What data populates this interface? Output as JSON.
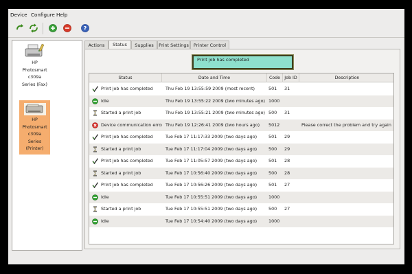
{
  "menubar": {
    "items": [
      "Device",
      "Configure",
      "Help"
    ]
  },
  "toolbar": {
    "buttons": [
      {
        "icon": "refresh-device-icon",
        "color": "#3a8a1c"
      },
      {
        "icon": "refresh-all-icon",
        "color": "#3a8a1c"
      },
      {
        "icon": "add-device-icon",
        "color": "#3aa23a"
      },
      {
        "icon": "remove-device-icon",
        "color": "#d83a2a"
      },
      {
        "icon": "help-icon",
        "color": "#3a62b8"
      }
    ]
  },
  "devices": [
    {
      "label_lines": [
        "HP",
        "Photosmart",
        "c309a",
        "Series (Fax)"
      ],
      "selected": false
    },
    {
      "label_lines": [
        "HP",
        "Photosmart",
        "c309a",
        "Series",
        "(Printer)"
      ],
      "selected": true
    }
  ],
  "tabs": [
    "Actions",
    "Status",
    "Supplies",
    "Print Settings",
    "Printer Control"
  ],
  "active_tab": "Status",
  "status_message": "Print job has completed",
  "table": {
    "columns": [
      "Status",
      "Date and Time",
      "Code",
      "Job ID",
      "Description"
    ],
    "rows": [
      {
        "icon": "check-icon",
        "status": "Print job has completed",
        "datetime": "Thu Feb 19 13:55:59 2009 (most recent)",
        "code": "501",
        "job": "31",
        "desc": ""
      },
      {
        "icon": "idle-icon",
        "status": "Idle",
        "datetime": "Thu Feb 19 13:55:22 2009 (two minutes ago)",
        "code": "1000",
        "job": "",
        "desc": ""
      },
      {
        "icon": "hourglass-icon",
        "status": "Started a print job",
        "datetime": "Thu Feb 19 13:55:21 2009 (two minutes ago)",
        "code": "500",
        "job": "31",
        "desc": ""
      },
      {
        "icon": "error-icon",
        "status": "Device communication error",
        "datetime": "Thu Feb 19 12:26:41 2009 (two hours ago)",
        "code": "5012",
        "job": "",
        "desc": "Please correct the problem and try again"
      },
      {
        "icon": "check-icon",
        "status": "Print job has completed",
        "datetime": "Tue Feb 17 11:17:33 2009 (two days ago)",
        "code": "501",
        "job": "29",
        "desc": ""
      },
      {
        "icon": "hourglass-icon",
        "status": "Started a print job",
        "datetime": "Tue Feb 17 11:17:04 2009 (two days ago)",
        "code": "500",
        "job": "29",
        "desc": ""
      },
      {
        "icon": "check-icon",
        "status": "Print job has completed",
        "datetime": "Tue Feb 17 11:05:57 2009 (two days ago)",
        "code": "501",
        "job": "28",
        "desc": ""
      },
      {
        "icon": "hourglass-icon",
        "status": "Started a print job",
        "datetime": "Tue Feb 17 10:56:40 2009 (two days ago)",
        "code": "500",
        "job": "28",
        "desc": ""
      },
      {
        "icon": "check-icon",
        "status": "Print job has completed",
        "datetime": "Tue Feb 17 10:56:26 2009 (two days ago)",
        "code": "501",
        "job": "27",
        "desc": ""
      },
      {
        "icon": "idle-icon",
        "status": "Idle",
        "datetime": "Tue Feb 17 10:55:51 2009 (two days ago)",
        "code": "1000",
        "job": "",
        "desc": ""
      },
      {
        "icon": "hourglass-icon",
        "status": "Started a print job",
        "datetime": "Tue Feb 17 10:55:51 2009 (two days ago)",
        "code": "500",
        "job": "27",
        "desc": ""
      },
      {
        "icon": "idle-icon",
        "status": "Idle",
        "datetime": "Tue Feb 17 10:54:40 2009 (two days ago)",
        "code": "1000",
        "job": "",
        "desc": ""
      }
    ]
  },
  "colors": {
    "selected_device": "#f5ad6e",
    "status_box": "#8ee0cd"
  }
}
